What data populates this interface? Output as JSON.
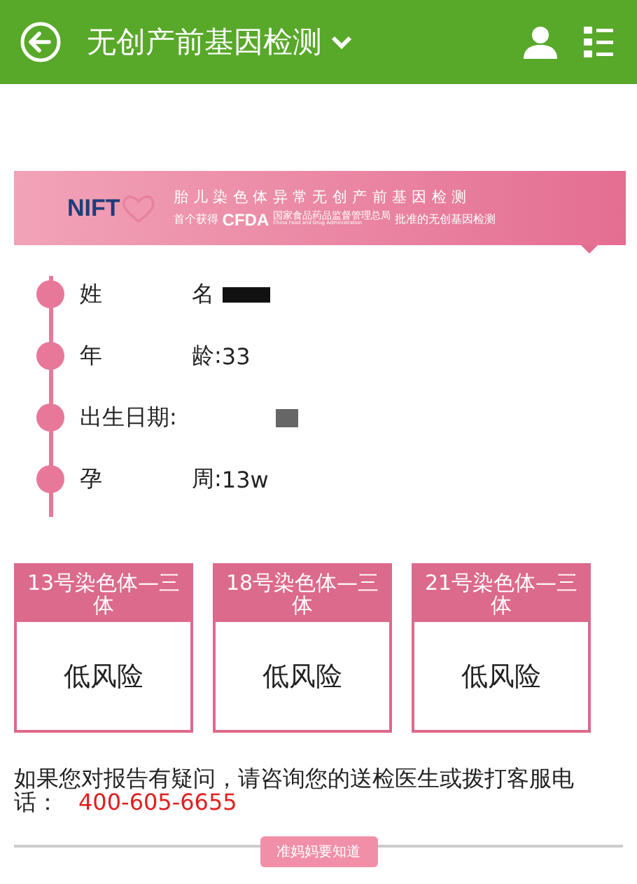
{
  "header": {
    "title": "无创产前基因检测"
  },
  "banner": {
    "logo": "NIFT",
    "headline": "胎儿染色体异常无创产前基因检测",
    "line_start": "首个获得",
    "cfda": "CFDA",
    "agency_cn": "国家食品药品监督管理总局",
    "agency_en": "China Food and Drug Administration",
    "line_end": "批准的无创基因检测"
  },
  "info": [
    {
      "label": "姓",
      "label_end": "名",
      "redacted": true
    },
    {
      "label": "年",
      "label_end": "龄:",
      "value": "33",
      "redacted": false
    },
    {
      "label": "出生日期:",
      "redacted": true
    },
    {
      "label": "孕",
      "label_end": "周:",
      "value": "13w",
      "redacted": false
    }
  ],
  "results": [
    {
      "title": "13号染色体—三体",
      "risk": "低风险"
    },
    {
      "title": "18号染色体—三体",
      "risk": "低风险"
    },
    {
      "title": "21号染色体—三体",
      "risk": "低风险"
    }
  ],
  "notice": {
    "text": "如果您对报告有疑问，请咨询您的送检医生或拨打客服电话：",
    "phone": "400-605-6655"
  },
  "section_label": "准妈妈要知道"
}
